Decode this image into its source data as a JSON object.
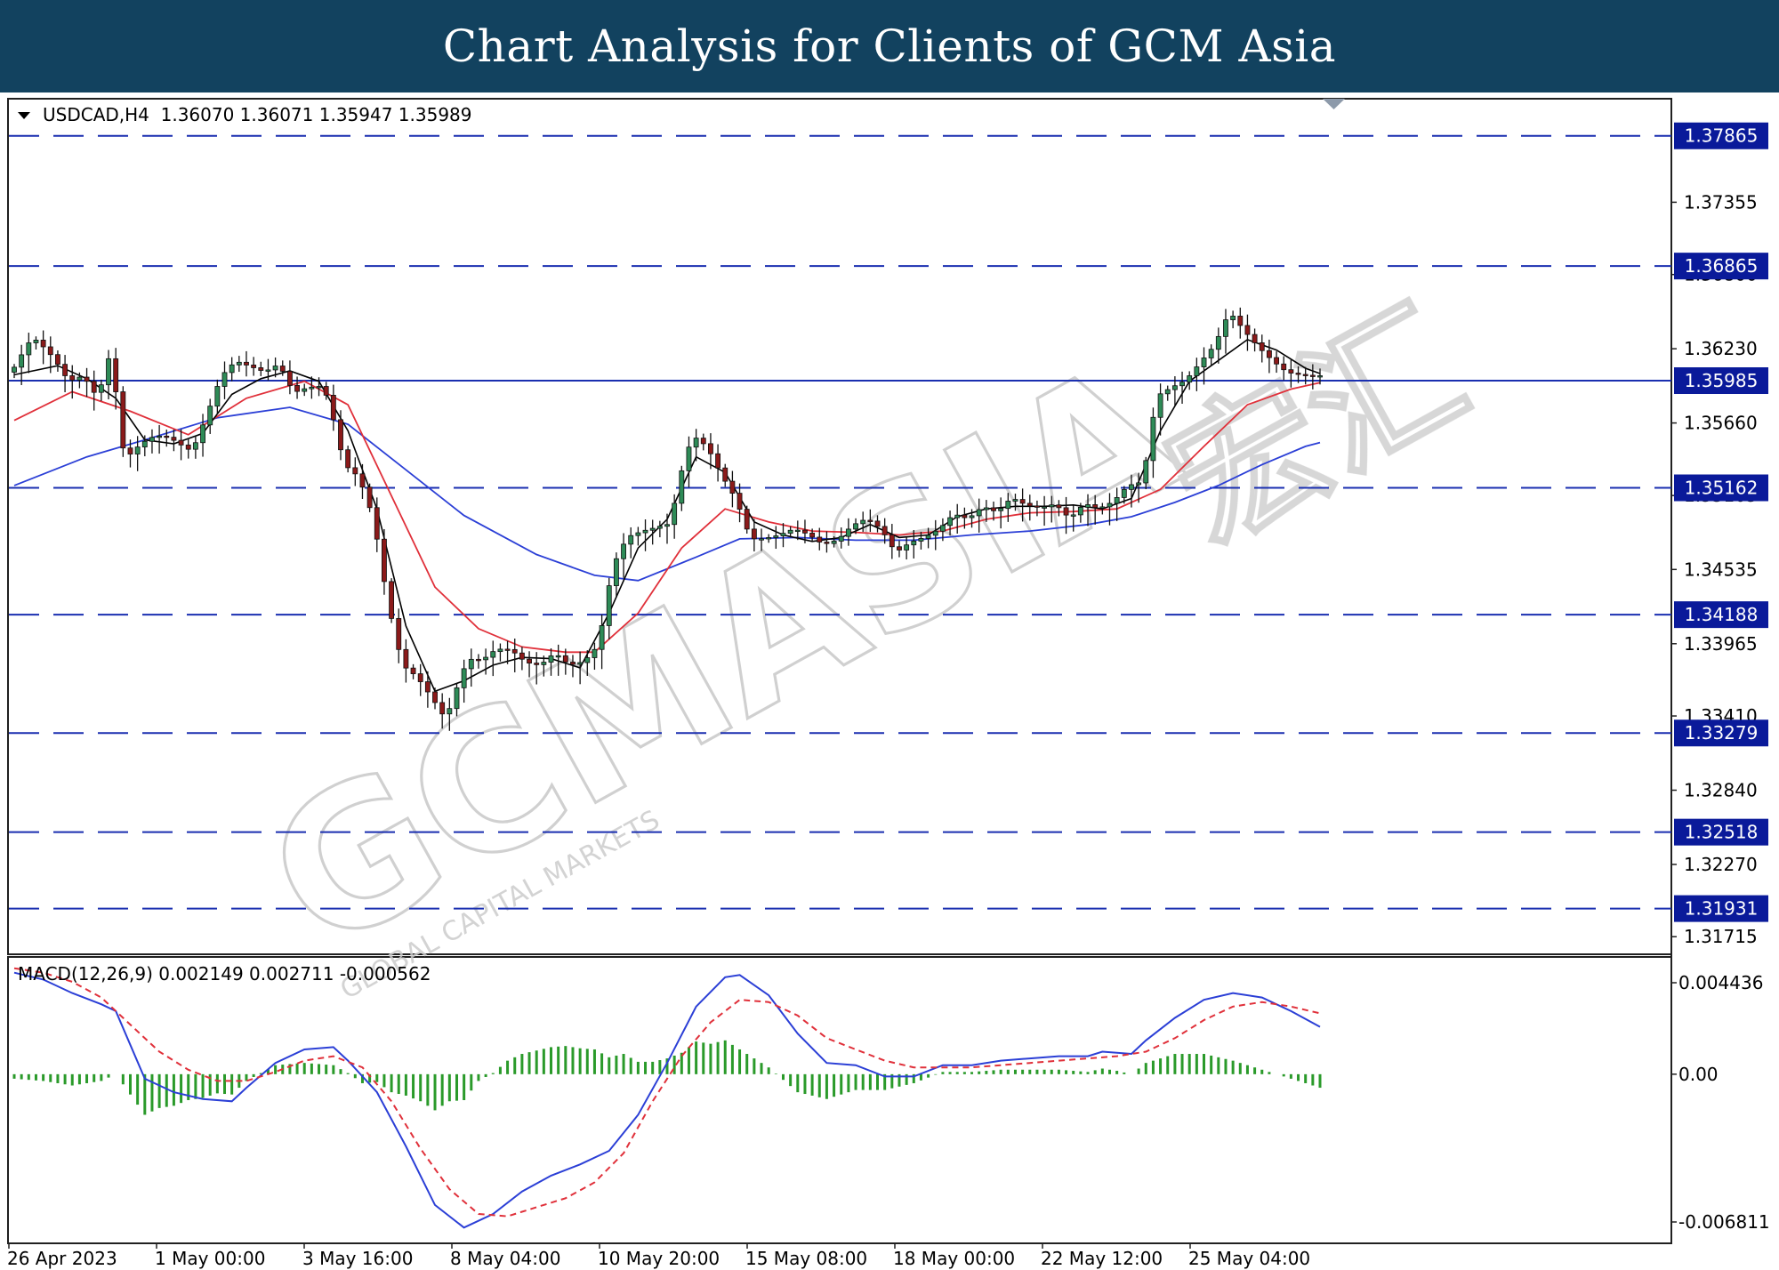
{
  "banner": {
    "title": "Chart Analysis for Clients of GCM Asia"
  },
  "watermark": {
    "brand": "GCMASIA",
    "tagline": "GLOBAL CAPITAL MARKETS",
    "chinese": "宏汇"
  },
  "colors": {
    "banner": "#12425f",
    "bull": "#2e8b57",
    "bear": "#8b1a1a",
    "ma_fast": "#000000",
    "ma_mid": "#e0303a",
    "ma_slow": "#2b3fd6",
    "level_line": "#1a2fb0",
    "macd_line": "#2b3fd6",
    "signal_line": "#e0303a",
    "histogram": "#2a9a2a"
  },
  "chart_data": [
    {
      "type": "candlestick",
      "title": "USDCAD,H4",
      "symbol": "USDCAD",
      "timeframe": "H4",
      "ohlc_header": {
        "open": "1.36070",
        "high": "1.36071",
        "low": "1.35947",
        "close": "1.35989"
      },
      "header_text": "USDCAD,H4  1.36070 1.36071 1.35947 1.35989",
      "ylim": [
        1.3158,
        1.3815
      ],
      "price_axis_ticks": [
        "1.37355",
        "1.36800",
        "1.36230",
        "1.35660",
        "1.35103",
        "1.34535",
        "1.33965",
        "1.33410",
        "1.32840",
        "1.32270",
        "1.31715"
      ],
      "levels": [
        "1.37865",
        "1.36865",
        "1.35985",
        "1.35162",
        "1.34188",
        "1.33279",
        "1.32518",
        "1.31931"
      ],
      "time_axis_labels": [
        "26 Apr 2023",
        "1 May 00:00",
        "3 May 16:00",
        "8 May 04:00",
        "10 May 20:00",
        "15 May 08:00",
        "18 May 00:00",
        "22 May 12:00",
        "25 May 04:00"
      ],
      "close_path": [
        [
          0,
          1.3605
        ],
        [
          3,
          1.3628
        ],
        [
          6,
          1.3612
        ],
        [
          8,
          1.3598
        ],
        [
          10,
          1.3606
        ],
        [
          12,
          1.359
        ],
        [
          14,
          1.3628
        ],
        [
          15,
          1.3555
        ],
        [
          16,
          1.3538
        ],
        [
          18,
          1.3546
        ],
        [
          20,
          1.3552
        ],
        [
          22,
          1.3553
        ],
        [
          25,
          1.3548
        ],
        [
          27,
          1.3576
        ],
        [
          29,
          1.3604
        ],
        [
          31,
          1.3612
        ],
        [
          33,
          1.3605
        ],
        [
          35,
          1.3601
        ],
        [
          37,
          1.361
        ],
        [
          39,
          1.3592
        ],
        [
          41,
          1.3598
        ],
        [
          43,
          1.3598
        ],
        [
          44,
          1.3582
        ],
        [
          46,
          1.3532
        ],
        [
          48,
          1.352
        ],
        [
          50,
          1.3489
        ],
        [
          52,
          1.3427
        ],
        [
          54,
          1.3383
        ],
        [
          56,
          1.3376
        ],
        [
          58,
          1.3359
        ],
        [
          60,
          1.3338
        ],
        [
          61,
          1.3353
        ],
        [
          63,
          1.338
        ],
        [
          65,
          1.338
        ],
        [
          67,
          1.3392
        ],
        [
          69,
          1.3395
        ],
        [
          71,
          1.3387
        ],
        [
          73,
          1.3383
        ],
        [
          75,
          1.3389
        ],
        [
          77,
          1.3376
        ],
        [
          79,
          1.3378
        ],
        [
          81,
          1.3393
        ],
        [
          83,
          1.3458
        ],
        [
          85,
          1.3483
        ],
        [
          87,
          1.3487
        ],
        [
          89,
          1.3487
        ],
        [
          91,
          1.3486
        ],
        [
          92,
          1.3516
        ],
        [
          94,
          1.3552
        ],
        [
          96,
          1.3546
        ],
        [
          98,
          1.3528
        ],
        [
          100,
          1.3512
        ],
        [
          102,
          1.3481
        ],
        [
          104,
          1.3478
        ],
        [
          106,
          1.3477
        ],
        [
          108,
          1.348
        ],
        [
          110,
          1.3477
        ],
        [
          112,
          1.3473
        ],
        [
          114,
          1.348
        ],
        [
          116,
          1.3492
        ],
        [
          118,
          1.3495
        ],
        [
          120,
          1.3483
        ],
        [
          122,
          1.3462
        ],
        [
          124,
          1.347
        ],
        [
          126,
          1.3477
        ],
        [
          128,
          1.3487
        ],
        [
          130,
          1.3501
        ],
        [
          132,
          1.3496
        ],
        [
          134,
          1.3502
        ],
        [
          136,
          1.3494
        ],
        [
          138,
          1.3504
        ],
        [
          140,
          1.35
        ],
        [
          142,
          1.3502
        ],
        [
          144,
          1.3508
        ],
        [
          146,
          1.3497
        ],
        [
          148,
          1.3506
        ],
        [
          150,
          1.3498
        ],
        [
          152,
          1.3501
        ],
        [
          154,
          1.3514
        ],
        [
          156,
          1.352
        ],
        [
          158,
          1.359
        ],
        [
          160,
          1.3598
        ],
        [
          162,
          1.3602
        ],
        [
          164,
          1.3612
        ],
        [
          166,
          1.3622
        ],
        [
          168,
          1.3647
        ],
        [
          170,
          1.3635
        ],
        [
          172,
          1.3626
        ],
        [
          174,
          1.3618
        ],
        [
          176,
          1.3609
        ],
        [
          178,
          1.3604
        ],
        [
          180,
          1.3599
        ]
      ],
      "ma_fast": [
        [
          0,
          1.3603
        ],
        [
          6,
          1.361
        ],
        [
          10,
          1.36
        ],
        [
          14,
          1.3585
        ],
        [
          18,
          1.3553
        ],
        [
          22,
          1.355
        ],
        [
          26,
          1.3558
        ],
        [
          30,
          1.3588
        ],
        [
          34,
          1.36
        ],
        [
          38,
          1.3606
        ],
        [
          42,
          1.3598
        ],
        [
          46,
          1.356
        ],
        [
          50,
          1.35
        ],
        [
          54,
          1.341
        ],
        [
          58,
          1.336
        ],
        [
          62,
          1.3368
        ],
        [
          66,
          1.338
        ],
        [
          70,
          1.3386
        ],
        [
          74,
          1.3385
        ],
        [
          78,
          1.3378
        ],
        [
          82,
          1.342
        ],
        [
          86,
          1.347
        ],
        [
          90,
          1.3492
        ],
        [
          94,
          1.354
        ],
        [
          98,
          1.3528
        ],
        [
          102,
          1.349
        ],
        [
          106,
          1.348
        ],
        [
          110,
          1.3475
        ],
        [
          114,
          1.3478
        ],
        [
          118,
          1.3488
        ],
        [
          122,
          1.3478
        ],
        [
          126,
          1.348
        ],
        [
          130,
          1.3494
        ],
        [
          134,
          1.35
        ],
        [
          138,
          1.3502
        ],
        [
          142,
          1.3502
        ],
        [
          146,
          1.3503
        ],
        [
          150,
          1.35
        ],
        [
          154,
          1.3508
        ],
        [
          158,
          1.356
        ],
        [
          162,
          1.3598
        ],
        [
          166,
          1.3614
        ],
        [
          170,
          1.363
        ],
        [
          174,
          1.3622
        ],
        [
          178,
          1.3608
        ],
        [
          180,
          1.3604
        ]
      ],
      "ma_mid": [
        [
          0,
          1.3568
        ],
        [
          8,
          1.359
        ],
        [
          16,
          1.3575
        ],
        [
          24,
          1.3557
        ],
        [
          32,
          1.3585
        ],
        [
          40,
          1.3598
        ],
        [
          46,
          1.358
        ],
        [
          52,
          1.351
        ],
        [
          58,
          1.344
        ],
        [
          64,
          1.3408
        ],
        [
          70,
          1.3394
        ],
        [
          76,
          1.339
        ],
        [
          80,
          1.339
        ],
        [
          86,
          1.342
        ],
        [
          92,
          1.347
        ],
        [
          98,
          1.35
        ],
        [
          104,
          1.349
        ],
        [
          110,
          1.3483
        ],
        [
          116,
          1.3482
        ],
        [
          122,
          1.348
        ],
        [
          128,
          1.3483
        ],
        [
          134,
          1.3492
        ],
        [
          140,
          1.3497
        ],
        [
          146,
          1.3498
        ],
        [
          152,
          1.35
        ],
        [
          158,
          1.3515
        ],
        [
          164,
          1.3548
        ],
        [
          170,
          1.358
        ],
        [
          176,
          1.3592
        ],
        [
          180,
          1.3597
        ]
      ],
      "ma_slow": [
        [
          0,
          1.3518
        ],
        [
          10,
          1.354
        ],
        [
          18,
          1.3553
        ],
        [
          28,
          1.357
        ],
        [
          38,
          1.3578
        ],
        [
          46,
          1.3565
        ],
        [
          54,
          1.353
        ],
        [
          62,
          1.3495
        ],
        [
          72,
          1.3465
        ],
        [
          80,
          1.3449
        ],
        [
          86,
          1.3445
        ],
        [
          94,
          1.3463
        ],
        [
          100,
          1.3477
        ],
        [
          108,
          1.3478
        ],
        [
          116,
          1.3476
        ],
        [
          124,
          1.3476
        ],
        [
          132,
          1.348
        ],
        [
          140,
          1.3483
        ],
        [
          148,
          1.3488
        ],
        [
          154,
          1.3494
        ],
        [
          160,
          1.3505
        ],
        [
          166,
          1.3518
        ],
        [
          172,
          1.3534
        ],
        [
          178,
          1.3548
        ],
        [
          180,
          1.3551
        ]
      ]
    },
    {
      "type": "line",
      "title": "MACD(12,26,9)",
      "header_text": "MACD(12,26,9) 0.002149 0.002711 -0.000562",
      "values": {
        "macd": "0.002149",
        "signal": "0.002711",
        "histogram": "-0.000562"
      },
      "ylim": [
        -0.0075,
        0.0052
      ],
      "axis_ticks": [
        "0.004436",
        "0.00",
        "-0.006811"
      ],
      "macd_path": [
        [
          0,
          0.0045
        ],
        [
          4,
          0.0042
        ],
        [
          8,
          0.0036
        ],
        [
          12,
          0.0031
        ],
        [
          14,
          0.0028
        ],
        [
          18,
          -0.0002
        ],
        [
          22,
          -0.0008
        ],
        [
          26,
          -0.0011
        ],
        [
          30,
          -0.0012
        ],
        [
          32,
          -0.0006
        ],
        [
          36,
          0.0005
        ],
        [
          40,
          0.0011
        ],
        [
          44,
          0.0012
        ],
        [
          46,
          0.0006
        ],
        [
          50,
          -0.0008
        ],
        [
          54,
          -0.0032
        ],
        [
          58,
          -0.0058
        ],
        [
          62,
          -0.0068
        ],
        [
          66,
          -0.0062
        ],
        [
          70,
          -0.0052
        ],
        [
          74,
          -0.0045
        ],
        [
          78,
          -0.004
        ],
        [
          82,
          -0.0034
        ],
        [
          86,
          -0.0018
        ],
        [
          90,
          0.0005
        ],
        [
          94,
          0.003
        ],
        [
          98,
          0.0043
        ],
        [
          100,
          0.0044
        ],
        [
          104,
          0.0035
        ],
        [
          108,
          0.0018
        ],
        [
          112,
          0.0005
        ],
        [
          116,
          0.0004
        ],
        [
          120,
          -0.0001
        ],
        [
          124,
          -0.0001
        ],
        [
          128,
          0.0004
        ],
        [
          132,
          0.0004
        ],
        [
          136,
          0.0006
        ],
        [
          140,
          0.0007
        ],
        [
          144,
          0.0008
        ],
        [
          148,
          0.0008
        ],
        [
          150,
          0.001
        ],
        [
          154,
          0.0009
        ],
        [
          156,
          0.0015
        ],
        [
          160,
          0.0025
        ],
        [
          164,
          0.0033
        ],
        [
          168,
          0.0036
        ],
        [
          172,
          0.0034
        ],
        [
          176,
          0.0028
        ],
        [
          180,
          0.0021
        ]
      ],
      "signal_path": [
        [
          0,
          0.0047
        ],
        [
          4,
          0.0045
        ],
        [
          8,
          0.0041
        ],
        [
          12,
          0.0034
        ],
        [
          16,
          0.0022
        ],
        [
          20,
          0.001
        ],
        [
          24,
          0.0002
        ],
        [
          28,
          -0.0003
        ],
        [
          32,
          -0.0003
        ],
        [
          36,
          0.0001
        ],
        [
          40,
          0.0006
        ],
        [
          44,
          0.0008
        ],
        [
          48,
          0.0003
        ],
        [
          52,
          -0.0012
        ],
        [
          56,
          -0.0033
        ],
        [
          60,
          -0.0051
        ],
        [
          64,
          -0.0062
        ],
        [
          68,
          -0.0063
        ],
        [
          72,
          -0.0059
        ],
        [
          76,
          -0.0055
        ],
        [
          80,
          -0.0048
        ],
        [
          84,
          -0.0035
        ],
        [
          88,
          -0.0012
        ],
        [
          92,
          0.0008
        ],
        [
          96,
          0.0023
        ],
        [
          100,
          0.0033
        ],
        [
          104,
          0.0032
        ],
        [
          108,
          0.0026
        ],
        [
          112,
          0.0016
        ],
        [
          116,
          0.0011
        ],
        [
          120,
          0.0006
        ],
        [
          124,
          0.0003
        ],
        [
          128,
          0.0003
        ],
        [
          132,
          0.0003
        ],
        [
          136,
          0.0004
        ],
        [
          140,
          0.0005
        ],
        [
          144,
          0.0006
        ],
        [
          148,
          0.0007
        ],
        [
          152,
          0.0008
        ],
        [
          156,
          0.001
        ],
        [
          160,
          0.0016
        ],
        [
          164,
          0.0024
        ],
        [
          168,
          0.003
        ],
        [
          172,
          0.0032
        ],
        [
          176,
          0.003
        ],
        [
          180,
          0.0027
        ]
      ]
    }
  ]
}
